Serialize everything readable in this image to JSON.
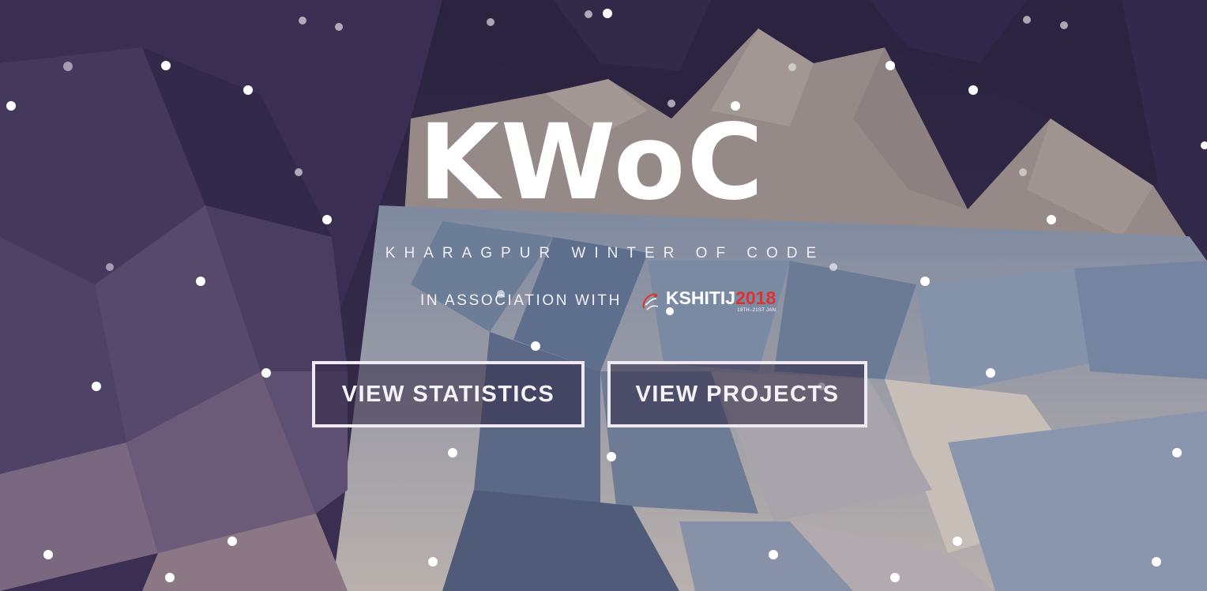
{
  "hero": {
    "title": "KWoC",
    "subtitle": "KHARAGPUR WINTER OF CODE",
    "association_text": "IN ASSOCIATION WITH",
    "sponsor": {
      "name": "KSHITIJ",
      "year": "2018",
      "dates": "19TH–21ST JAN",
      "icon": "kshitij-logo-icon"
    }
  },
  "buttons": {
    "statistics_label": "VIEW STATISTICS",
    "projects_label": "VIEW PROJECTS"
  },
  "colors": {
    "sky": "#2d2540",
    "mountain": "#8e8380",
    "accent_red": "#e0312d",
    "text": "#ffffff"
  }
}
